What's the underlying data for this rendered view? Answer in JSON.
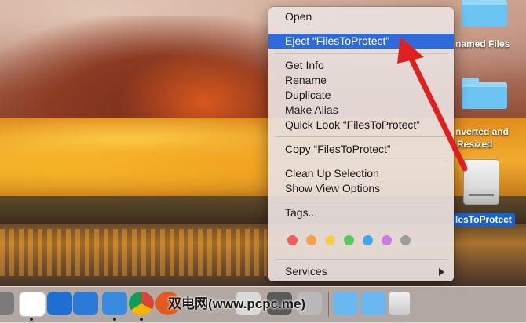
{
  "desktop": {
    "items": [
      {
        "label": "named Files"
      },
      {
        "label": "nverted and"
      },
      {
        "label": "Resized"
      },
      {
        "label": "lesToProtect"
      }
    ]
  },
  "context_menu": {
    "group1": [
      {
        "label": "Open"
      },
      {
        "label": "Eject “FilesToProtect”",
        "highlighted": true
      }
    ],
    "group2": [
      {
        "label": "Get Info"
      },
      {
        "label": "Rename"
      },
      {
        "label": "Duplicate"
      },
      {
        "label": "Make Alias"
      },
      {
        "label": "Quick Look “FilesToProtect”"
      }
    ],
    "group3": [
      {
        "label": "Copy “FilesToProtect”"
      }
    ],
    "group4": [
      {
        "label": "Clean Up Selection"
      },
      {
        "label": "Show View Options"
      }
    ],
    "tags_label": "Tags...",
    "tag_colors": [
      "#f05b5b",
      "#f4a24c",
      "#f5cf4a",
      "#58c95b",
      "#3fa6ee",
      "#c97be0",
      "#9c9c9c"
    ],
    "services_label": "Services"
  },
  "annotation": {
    "color": "#e02020"
  },
  "dock": {
    "watermark": "双电网(www.pcpc.me)"
  },
  "colors": {
    "highlight": "#2f6bd8",
    "folder": "#6cc4f5"
  }
}
